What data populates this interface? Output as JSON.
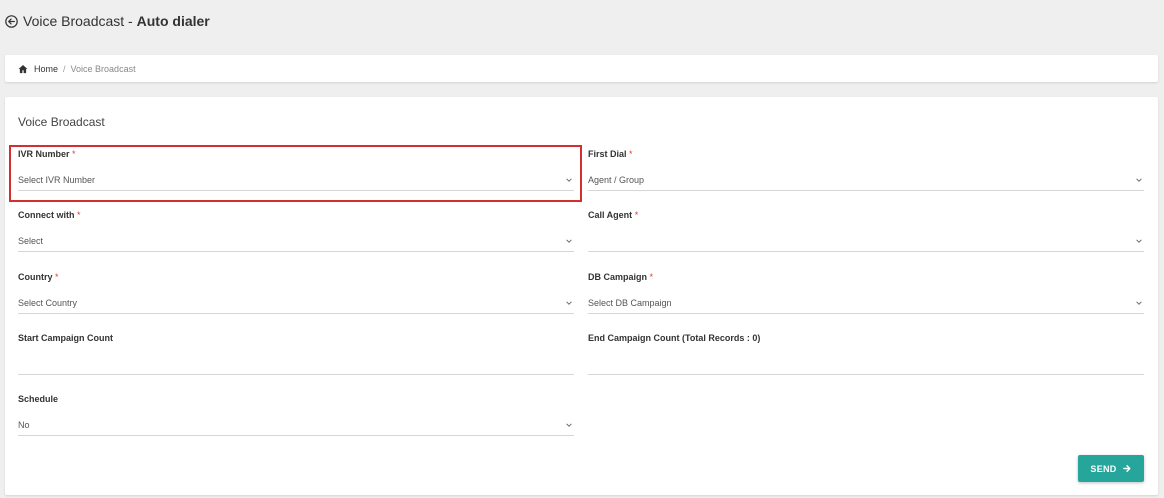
{
  "header": {
    "title_prefix": "Voice Broadcast - ",
    "title_bold": "Auto dialer"
  },
  "breadcrumb": {
    "home": "Home",
    "separator": "/",
    "current": "Voice Broadcast"
  },
  "form": {
    "title": "Voice Broadcast",
    "required_mark": "*",
    "ivr_number": {
      "label": "IVR Number",
      "value": "Select IVR Number",
      "required": true
    },
    "first_dial": {
      "label": "First Dial",
      "value": "Agent / Group",
      "required": true
    },
    "connect_with": {
      "label": "Connect with",
      "value": "Select",
      "required": true
    },
    "call_agent": {
      "label": "Call Agent",
      "value": "",
      "required": true
    },
    "country": {
      "label": "Country",
      "value": "Select Country",
      "required": true
    },
    "db_campaign": {
      "label": "DB Campaign",
      "value": "Select DB Campaign",
      "required": true
    },
    "start_campaign_count": {
      "label": "Start Campaign Count",
      "value": ""
    },
    "end_campaign_count": {
      "label": "End Campaign Count (Total Records : 0)",
      "value": ""
    },
    "schedule": {
      "label": "Schedule",
      "value": "No"
    },
    "send_label": "SEND"
  },
  "colors": {
    "accent": "#26a69a",
    "required": "#e53935",
    "highlight": "#d32f2f",
    "background": "#efefef"
  },
  "icons": {
    "back": "back-arrow-circle-icon",
    "home": "home-icon",
    "chevron": "chevron-down-icon",
    "send_arrow": "arrow-right-icon"
  }
}
